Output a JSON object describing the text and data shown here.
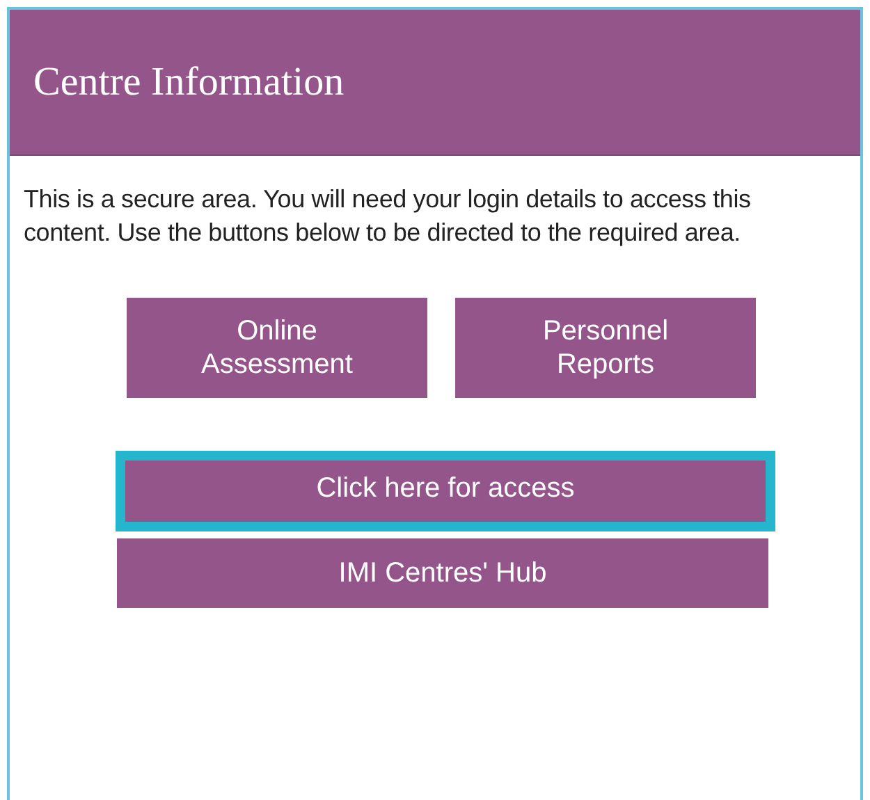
{
  "panel": {
    "title": "Centre Information",
    "intro": "This is a secure area. You will need your login details to access this content. Use the buttons below to be directed to the required area."
  },
  "button_pair": [
    {
      "label": "Online\nAssessment"
    },
    {
      "label": "Personnel\nReports"
    }
  ],
  "wide_buttons": [
    {
      "label": "Click here for access",
      "highlighted": true
    },
    {
      "label": "IMI Centres' Hub",
      "highlighted": false
    }
  ]
}
